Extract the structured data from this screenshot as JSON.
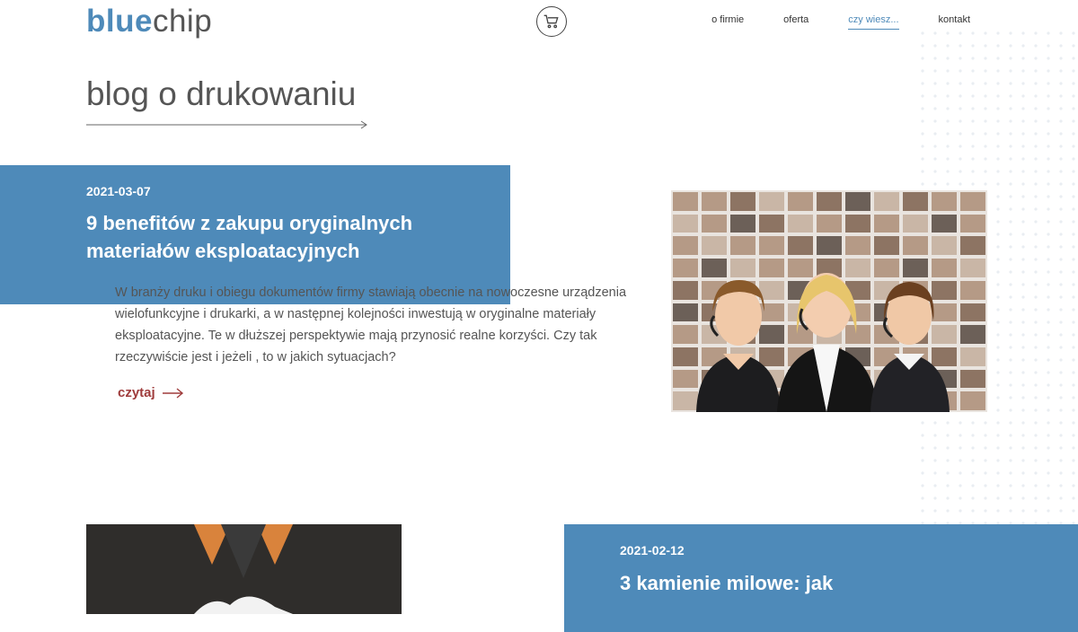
{
  "header": {
    "logo_part1": "blue",
    "logo_part2": "chip",
    "nav": [
      {
        "label": "o firmie"
      },
      {
        "label": "oferta"
      },
      {
        "label": "czy wiesz..."
      },
      {
        "label": "kontakt"
      }
    ]
  },
  "page": {
    "title": "blog o drukowaniu"
  },
  "posts": [
    {
      "date": "2021-03-07",
      "title": "9 benefitów z zakupu oryginalnych materiałów eksploatacyjnych",
      "excerpt": "W branży druku i obiegu dokumentów firmy stawiają obecnie na nowoczesne urządzenia wielofunkcyjne i drukarki, a w następnej kolejności inwestują w oryginalne materiały eksploatacyjne. Te w dłuższej perspektywie mają przynosić realne korzyści. Czy tak rzeczywiście jest i jeżeli , to w jakich sytuacjach?",
      "read_more": "czytaj"
    },
    {
      "date": "2021-02-12",
      "title": "3 kamienie milowe: jak"
    }
  ],
  "colors": {
    "brand_blue": "#4e8ab9",
    "link_red": "#9f3c3c"
  },
  "icons": [
    "cart-icon",
    "arrow-right-icon"
  ]
}
